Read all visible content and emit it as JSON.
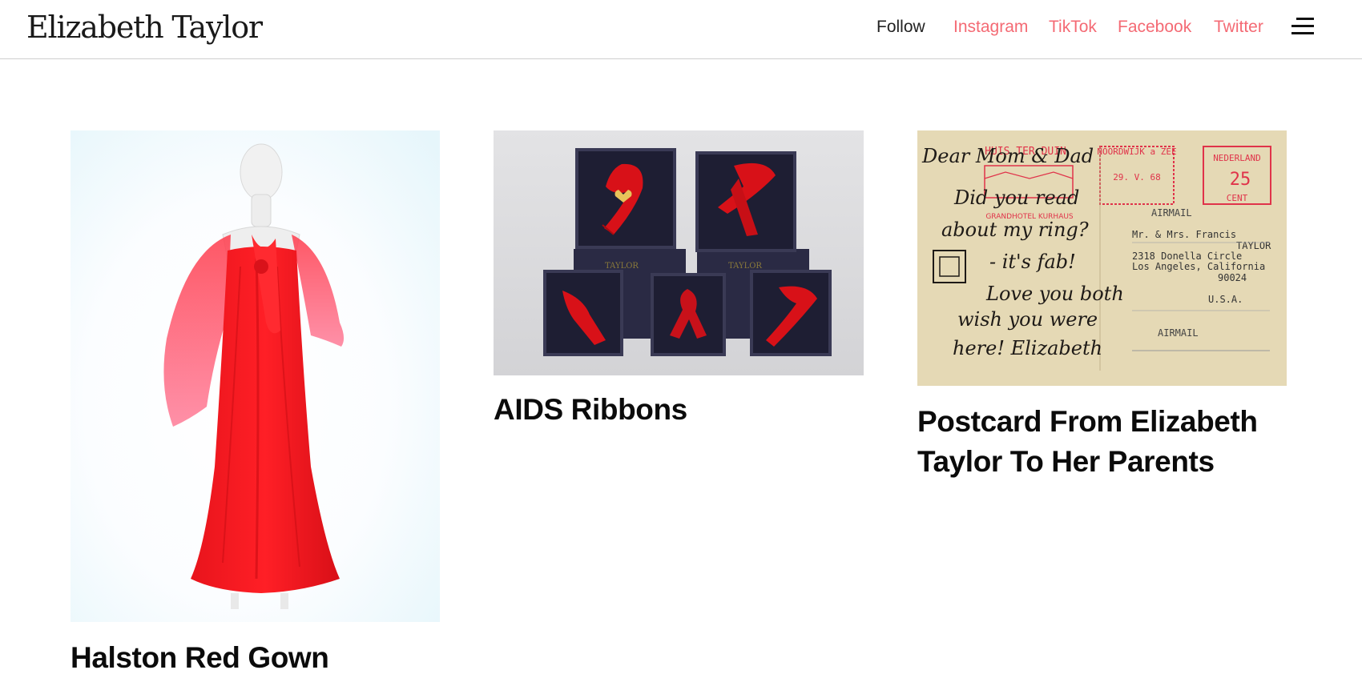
{
  "site": {
    "logo": "Elizabeth Taylor"
  },
  "nav": {
    "follow_label": "Follow",
    "links": [
      "Instagram",
      "TikTok",
      "Facebook",
      "Twitter"
    ],
    "link_color": "#f46a74"
  },
  "menu": {
    "icon": "hamburger-menu-icon"
  },
  "cards": [
    {
      "title": "Halston Red Gown",
      "image": "red-chiffon-gown-on-mannequin"
    },
    {
      "title": "AIDS Ribbons",
      "image": "red-ribbon-pins-in-boxes"
    },
    {
      "title": "Postcard From Elizabeth Taylor To Her Parents",
      "image": "handwritten-postcard",
      "postcard_text": {
        "hotel": "HUIS TER DUIN",
        "town": "NOORDWIJK a ZEE",
        "postmark_date": "29. V. 68",
        "stamp_country": "NEDERLAND",
        "stamp_value": "25",
        "stamp_unit": "CENT",
        "hotel_sub": "GRANDHOTEL KURHAUS",
        "airmail_top": "AIRMAIL",
        "addr_1": "Mr. & Mrs. Francis",
        "addr_2": "TAYLOR",
        "addr_3": "2318 Donella Circle",
        "addr_4": "Los Angeles, California",
        "addr_5": "90024",
        "addr_6": "U.S.A.",
        "airmail_bottom": "AIRMAIL",
        "hand_1": "Dear Mom & Dad",
        "hand_2": "Did you read",
        "hand_3": "about my ring?",
        "hand_4": "- it's fab!",
        "hand_5": "Love you both",
        "hand_6": "wish you were",
        "hand_7": "here! Elizabeth"
      }
    }
  ]
}
